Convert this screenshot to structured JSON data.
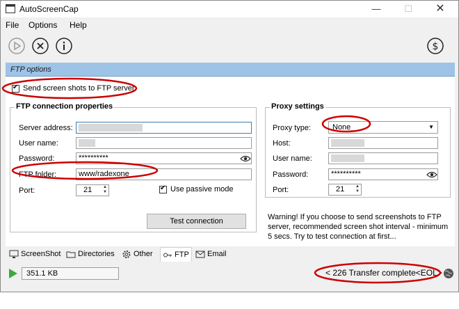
{
  "window": {
    "title": "AutoScreenCap",
    "minimize": "—",
    "maximize": "☐",
    "close": "✕"
  },
  "menu": [
    {
      "label": "File"
    },
    {
      "label": "Options"
    },
    {
      "label": "Help"
    }
  ],
  "toolbar": {
    "icons": [
      "play-icon",
      "stop-icon",
      "info-icon",
      "donate-dollar-icon"
    ]
  },
  "section": {
    "title": "FTP options"
  },
  "ftp": {
    "send_label": "Send screen shots to FTP server",
    "send_checked": true,
    "group_title": "FTP connection properties",
    "server_label": "Server address:",
    "user_label": "User name:",
    "password_label": "Password:",
    "password_value": "**********",
    "folder_label": "FTP folder:",
    "folder_value": "www/radexone",
    "port_label": "Port:",
    "port_value": "21",
    "passive_label": "Use passive mode",
    "passive_checked": true,
    "test_button": "Test connection"
  },
  "proxy": {
    "group_title": "Proxy settings",
    "type_label": "Proxy type:",
    "type_value": "None",
    "host_label": "Host:",
    "user_label": "User name:",
    "password_label": "Password:",
    "password_value": "**********",
    "port_label": "Port:",
    "port_value": "21"
  },
  "warning": "Warning! If you choose to send screenshots to FTP server, recommended screen shot interval - minimum 5 secs. Try to test connection at first...",
  "tabs": [
    {
      "label": "ScreenShot",
      "icon": "screenshot-icon"
    },
    {
      "label": "Directories",
      "icon": "folder-icon"
    },
    {
      "label": "Other",
      "icon": "gear-icon"
    },
    {
      "label": "FTP",
      "icon": "ftp-icon",
      "active": true
    },
    {
      "label": "Email",
      "icon": "email-icon"
    }
  ],
  "status": {
    "size": "351.1 KB",
    "message": "< 226 Transfer complete<EOL>"
  },
  "colors": {
    "section_header": "#9dc3e6",
    "annotation": "#cc0000",
    "play": "#3caa3c"
  }
}
